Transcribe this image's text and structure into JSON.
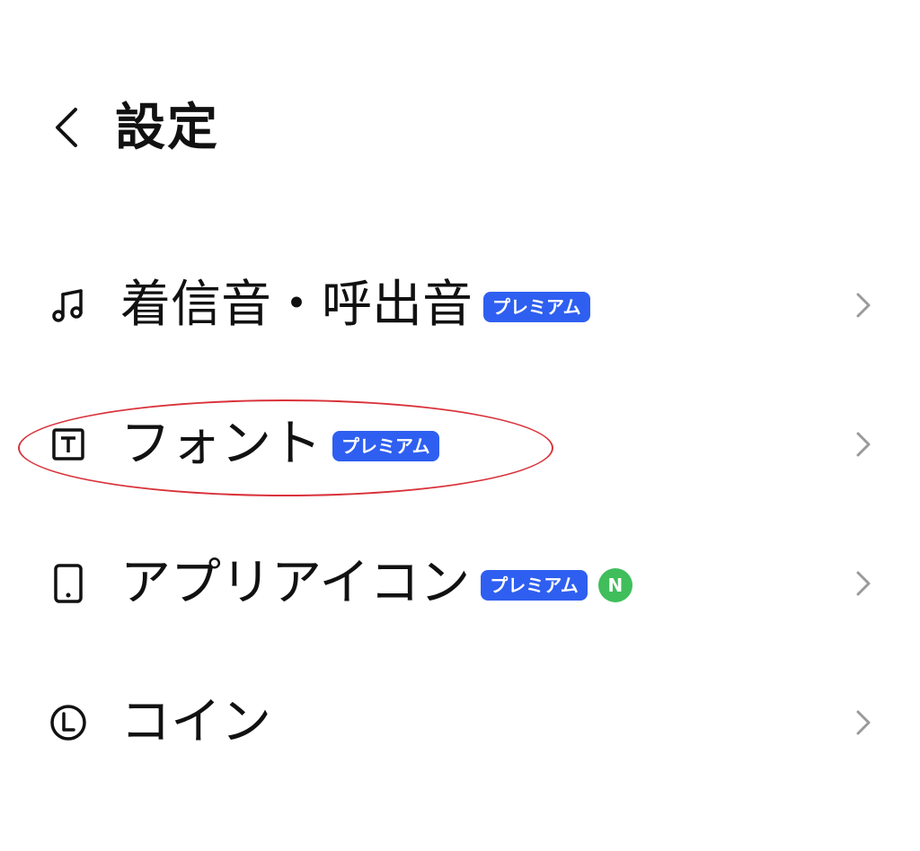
{
  "header": {
    "title": "設定",
    "back_icon": "chevron-left-icon"
  },
  "colors": {
    "premium_badge": "#2f5ff0",
    "new_dot": "#3fbe5b",
    "highlight_ring": "#d9323a",
    "chevron": "#9a9a9a"
  },
  "settings": {
    "items": [
      {
        "label": "着信音・呼出音",
        "icon": "music-note-icon",
        "badge": "プレミアム",
        "new": ""
      },
      {
        "label": "フォント",
        "icon": "font-t-icon",
        "badge": "プレミアム",
        "new": ""
      },
      {
        "label": "アプリアイコン",
        "icon": "phone-device-icon",
        "badge": "プレミアム",
        "new": "N"
      },
      {
        "label": "コイン",
        "icon": "coin-l-icon",
        "badge": "",
        "new": ""
      }
    ]
  }
}
